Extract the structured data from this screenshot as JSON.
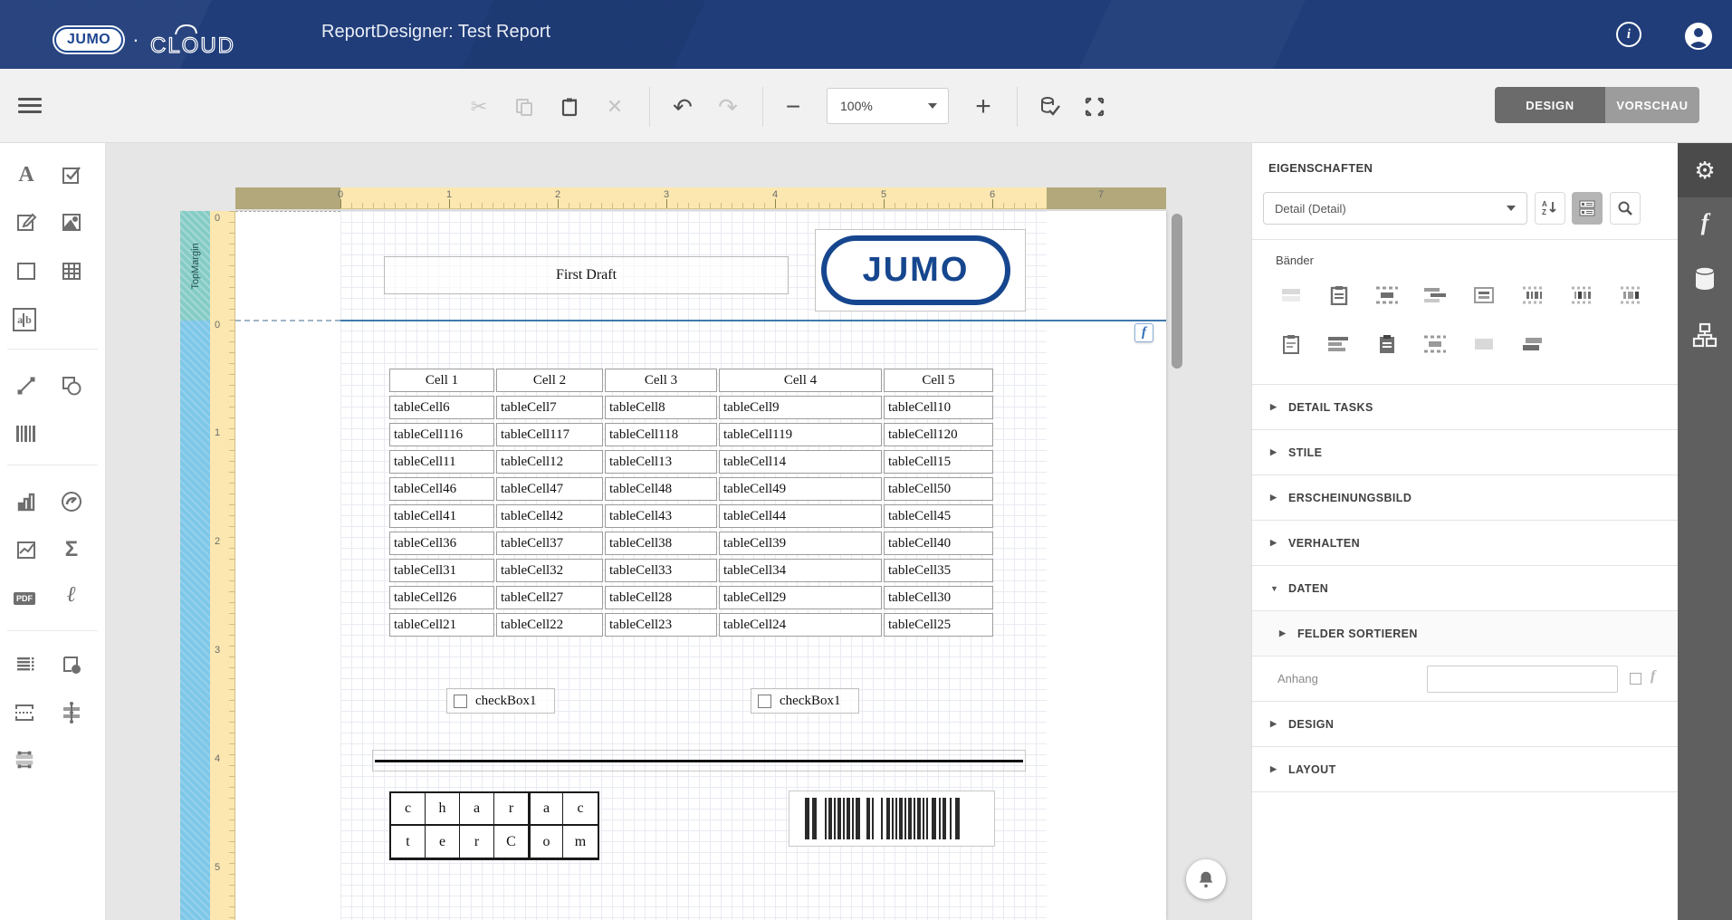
{
  "header": {
    "brand": "JUMO",
    "brand_separator": "·",
    "brand_suffix": "CLOUD",
    "title": "ReportDesigner: Test Report"
  },
  "toolbar": {
    "zoom_value": "100%",
    "design_label": "DESIGN",
    "preview_label": "VORSCHAU"
  },
  "icons": {
    "cut": "✂",
    "close": "✕",
    "undo": "↶",
    "redo": "↷",
    "minus": "−",
    "plus": "+",
    "gear": "⚙",
    "function": "f",
    "sigma": "Σ",
    "label_tool": "A",
    "pdf": "PDF",
    "signature": "ℓ",
    "info": "i"
  },
  "left_toolbox": {
    "tools": [
      "label",
      "check-box",
      "rich-text",
      "picture-box",
      "panel",
      "table",
      "character-comb",
      "line",
      "shape",
      "barcode",
      "chart",
      "gauge",
      "sparkline",
      "summary",
      "pdf-content",
      "signature",
      "table-of-contents",
      "page-info",
      "page-break",
      "cross-band-line",
      "subreport"
    ]
  },
  "ruler": {
    "h": [
      "0",
      "1",
      "2",
      "3",
      "4",
      "5",
      "6",
      "7"
    ],
    "v": [
      "0",
      "0",
      "1",
      "2",
      "3",
      "4",
      "5"
    ]
  },
  "canvas": {
    "top_band_label": "TopMargin",
    "first_draft_label": "First Draft",
    "logo_text": "JUMO",
    "band_function_badge": "f",
    "table": {
      "headers": [
        "Cell 1",
        "Cell 2",
        "Cell 3",
        "Cell 4",
        "Cell 5"
      ],
      "rows": [
        [
          "tableCell6",
          "tableCell7",
          "tableCell8",
          "tableCell9",
          "tableCell10"
        ],
        [
          "tableCell116",
          "tableCell117",
          "tableCell118",
          "tableCell119",
          "tableCell120"
        ],
        [
          "tableCell11",
          "tableCell12",
          "tableCell13",
          "tableCell14",
          "tableCell15"
        ],
        [
          "tableCell46",
          "tableCell47",
          "tableCell48",
          "tableCell49",
          "tableCell50"
        ],
        [
          "tableCell41",
          "tableCell42",
          "tableCell43",
          "tableCell44",
          "tableCell45"
        ],
        [
          "tableCell36",
          "tableCell37",
          "tableCell38",
          "tableCell39",
          "tableCell40"
        ],
        [
          "tableCell31",
          "tableCell32",
          "tableCell33",
          "tableCell34",
          "tableCell35"
        ],
        [
          "tableCell26",
          "tableCell27",
          "tableCell28",
          "tableCell29",
          "tableCell30"
        ],
        [
          "tableCell21",
          "tableCell22",
          "tableCell23",
          "tableCell24",
          "tableCell25"
        ]
      ]
    },
    "checkboxes": [
      {
        "label": "checkBox1"
      },
      {
        "label": "checkBox1"
      }
    ],
    "char_comb": {
      "rows": [
        [
          "c",
          "h",
          "a",
          "r",
          "a",
          "c"
        ],
        [
          "t",
          "e",
          "r",
          "C",
          "o",
          "m"
        ]
      ]
    }
  },
  "properties": {
    "heading": "EIGENSCHAFTEN",
    "selected_element": "Detail (Detail)",
    "bands_label": "Bänder",
    "band_icons": [
      "band-1",
      "band-2",
      "band-3",
      "band-4",
      "band-5",
      "band-6",
      "band-7",
      "band-8",
      "band-9",
      "band-10",
      "band-11",
      "band-12",
      "band-13",
      "band-14"
    ],
    "sections": [
      {
        "label": "DETAIL TASKS",
        "arrow": "▶"
      },
      {
        "label": "STILE",
        "arrow": "▶"
      },
      {
        "label": "ERSCHEINUNGSBILD",
        "arrow": "▶"
      },
      {
        "label": "VERHALTEN",
        "arrow": "▶"
      },
      {
        "label": "DATEN",
        "arrow": "▼"
      },
      {
        "label": "FELDER SORTIEREN",
        "arrow": "▶"
      },
      {
        "label": "DESIGN",
        "arrow": "▶"
      },
      {
        "label": "LAYOUT",
        "arrow": "▶"
      }
    ],
    "anhang_label": "Anhang",
    "anhang_value": ""
  },
  "colors": {
    "header_navy": "#203d7a",
    "jumo_blue": "#16468e",
    "ruler_yellow": "#fbe7af",
    "ruler_olive": "#b2a87b",
    "band_teal": "#85cbc6",
    "band_blue": "#7ec7e8",
    "band_line_blue": "#4079ad"
  }
}
